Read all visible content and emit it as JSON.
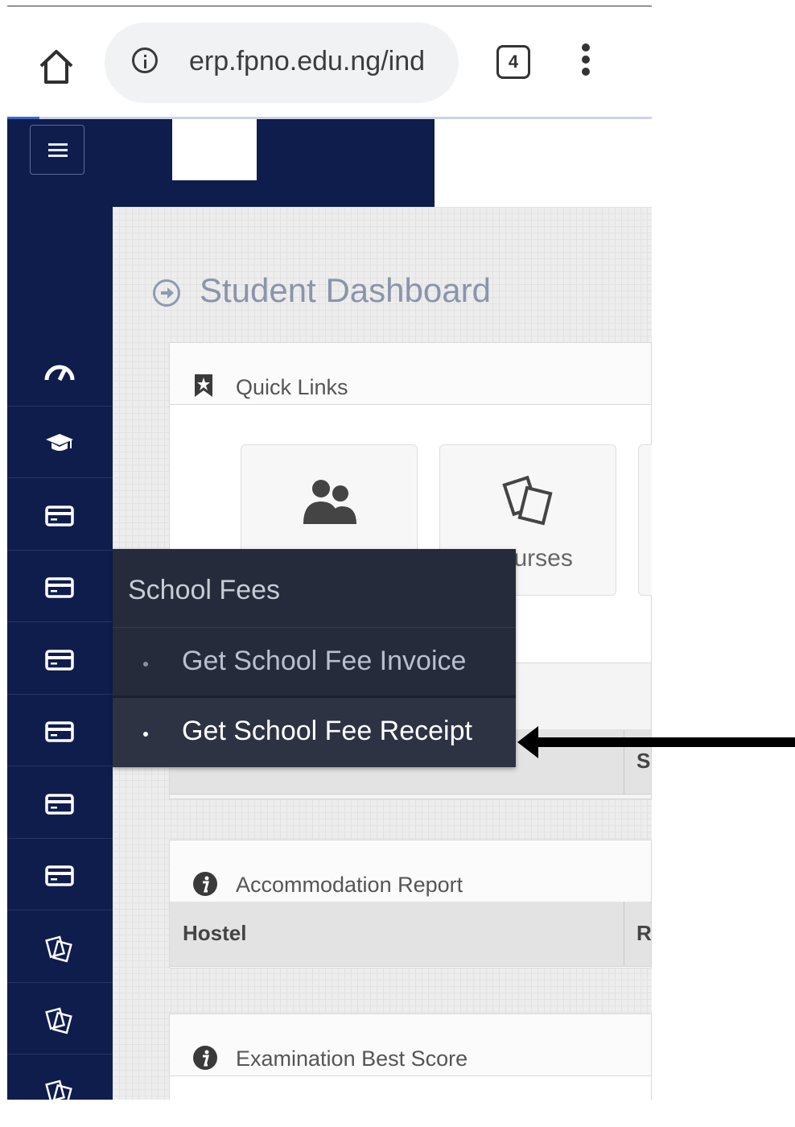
{
  "browser": {
    "url": "erp.fpno.edu.ng/ind",
    "tab_count": "4",
    "icons": [
      "home-icon",
      "info-icon",
      "tabs-counter-icon",
      "overflow-menu-icon"
    ]
  },
  "sidebar": {
    "items": [
      {
        "icon": "dashboard-gauge-icon"
      },
      {
        "icon": "graduation-cap-icon"
      },
      {
        "icon": "credit-card-icon"
      },
      {
        "icon": "credit-card-icon"
      },
      {
        "icon": "credit-card-icon"
      },
      {
        "icon": "credit-card-icon"
      },
      {
        "icon": "credit-card-icon"
      },
      {
        "icon": "credit-card-icon"
      },
      {
        "icon": "cards-icon"
      },
      {
        "icon": "cards-icon"
      },
      {
        "icon": "cards-icon"
      }
    ]
  },
  "page": {
    "title": "Student Dashboard"
  },
  "quick_links": {
    "title": "Quick Links",
    "tiles": [
      {
        "label": "",
        "icon": "users-icon"
      },
      {
        "label": "Courses",
        "icon": "cards-icon"
      }
    ]
  },
  "payments_panel": {
    "col_2_fragment": "S"
  },
  "accommodation": {
    "title": "Accommodation Report",
    "col_1": "Hostel",
    "col_2_fragment": "R"
  },
  "exam_best": {
    "title": "Examination Best Score"
  },
  "flyout": {
    "title": "School Fees",
    "items": [
      {
        "label": "Get School Fee Invoice",
        "highlighted": false
      },
      {
        "label": "Get School Fee Receipt",
        "highlighted": true
      }
    ]
  },
  "colors": {
    "sidebar_bg": "#0f1d4d",
    "flyout_bg": "#252b3a",
    "flyout_highlight": "#2d3343"
  }
}
